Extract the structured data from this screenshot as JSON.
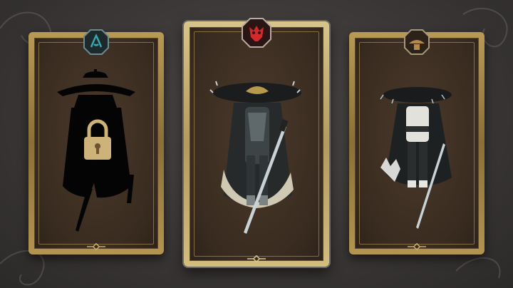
{
  "screen": {
    "background": "#3a3736"
  },
  "cards": [
    {
      "id": "locked",
      "state": "locked",
      "badge_icon": "water-sigil-icon",
      "badge_color": "#2f8f9a",
      "lock_icon": "padlock-icon"
    },
    {
      "id": "selected",
      "state": "selected",
      "badge_icon": "demon-mask-sigil-icon",
      "badge_color": "#c0262a"
    },
    {
      "id": "owned",
      "state": "unlocked",
      "badge_icon": "straw-hat-sigil-icon",
      "badge_color": "#a77b47"
    }
  ],
  "colors": {
    "frame_gold": "#b89a55",
    "frame_selected": "#d8c48a",
    "card_inner": "#3a2c20"
  }
}
